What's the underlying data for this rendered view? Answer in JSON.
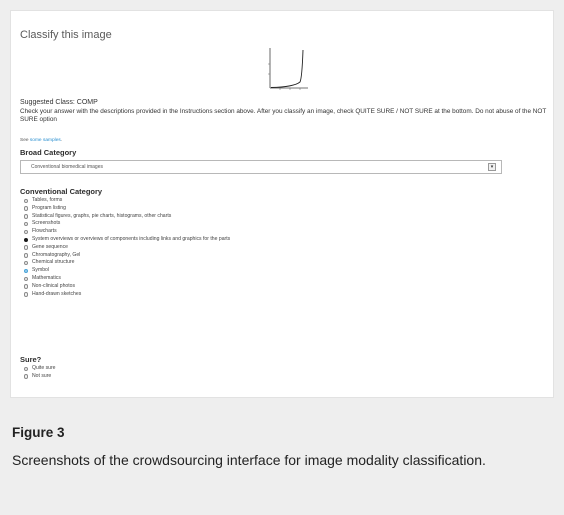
{
  "form": {
    "title": "Classify this image",
    "suggested_class": "Suggested Class: COMP",
    "instructions": "Check your answer with the descriptions provided in the Instructions section above. After you classify an image, check QUITE SURE / NOT SURE at the bottom. Do not abuse of the NOT SURE option",
    "see_prefix": "See ",
    "see_link": "some samples",
    "see_suffix": ".",
    "broad_category": {
      "label": "Broad Category",
      "selected": "Conventional biomedical images",
      "arrow_icon": "chevron-down-icon"
    },
    "conventional_category": {
      "label": "Conventional Category",
      "options": [
        {
          "label": "Tables, forms",
          "state": "unchecked"
        },
        {
          "label": "Program listing",
          "state": "unchecked"
        },
        {
          "label": "Statistical figures, graphs, pie charts, histograms, other charts",
          "state": "unchecked"
        },
        {
          "label": "Screenshots",
          "state": "unchecked"
        },
        {
          "label": "Flowcharts",
          "state": "unchecked"
        },
        {
          "label": "System overviews or overviews of components including links and graphics for the parts",
          "state": "checked"
        },
        {
          "label": "Gene sequence",
          "state": "unchecked"
        },
        {
          "label": "Chromatography, Gel",
          "state": "unchecked"
        },
        {
          "label": "Chemical structure",
          "state": "unchecked"
        },
        {
          "label": "Symbol",
          "state": "focused"
        },
        {
          "label": "Mathematics",
          "state": "unchecked"
        },
        {
          "label": "Non-clinical photos",
          "state": "unchecked"
        },
        {
          "label": "Hand-drawn sketches",
          "state": "unchecked"
        }
      ]
    },
    "sure": {
      "label": "Sure?",
      "options": [
        {
          "label": "Quite sure",
          "state": "unchecked"
        },
        {
          "label": "Not sure",
          "state": "unchecked"
        }
      ]
    }
  },
  "figure": {
    "title": "Figure 3",
    "caption": "Screenshots of the crowdsourcing interface for image modality classification."
  },
  "colors": {
    "page_background": "#eeeeee",
    "panel_background": "#ffffff",
    "link": "#2a8fd0",
    "checked_radio": "#1a1a1a",
    "focused_radio": "#9ad0ef"
  }
}
